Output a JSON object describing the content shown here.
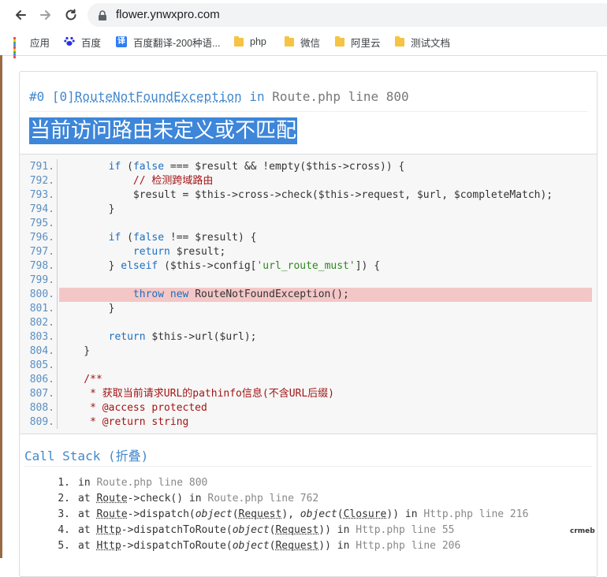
{
  "browser": {
    "url": "flower.ynwxpro.com",
    "bookmarks": [
      "应用",
      "百度",
      "百度翻译-200种语...",
      "php",
      "微信",
      "阿里云",
      "测试文档"
    ]
  },
  "exception": {
    "header_prefix": "#0 [0]",
    "header_class": "RouteNotFoundException",
    "header_in": "in",
    "header_location": "Route.php line 800",
    "message": "当前访问路由未定义或不匹配"
  },
  "source": {
    "highlight_line": "800.",
    "lines": [
      {
        "no": "791.",
        "code": "        if (false === $result && !empty($this->cross)) {"
      },
      {
        "no": "792.",
        "code": "            // 检测跨域路由"
      },
      {
        "no": "793.",
        "code": "            $result = $this->cross->check($this->request, $url, $completeMatch);"
      },
      {
        "no": "794.",
        "code": "        }"
      },
      {
        "no": "795.",
        "code": ""
      },
      {
        "no": "796.",
        "code": "        if (false !== $result) {"
      },
      {
        "no": "797.",
        "code": "            return $result;"
      },
      {
        "no": "798.",
        "code": "        } elseif ($this->config['url_route_must']) {"
      },
      {
        "no": "799.",
        "code": ""
      },
      {
        "no": "800.",
        "code": "            throw new RouteNotFoundException();"
      },
      {
        "no": "801.",
        "code": "        }"
      },
      {
        "no": "802.",
        "code": ""
      },
      {
        "no": "803.",
        "code": "        return $this->url($url);"
      },
      {
        "no": "804.",
        "code": "    }"
      },
      {
        "no": "805.",
        "code": ""
      },
      {
        "no": "806.",
        "code": "    /**"
      },
      {
        "no": "807.",
        "code": "     * 获取当前请求URL的pathinfo信息(不含URL后缀)"
      },
      {
        "no": "808.",
        "code": "     * @access protected"
      },
      {
        "no": "809.",
        "code": "     * @return string"
      }
    ]
  },
  "callstack": {
    "title": "Call Stack (折叠)",
    "items": [
      {
        "num": "1.",
        "parts": [
          {
            "t": "in ",
            "c": ""
          },
          {
            "t": "Route.php line 800",
            "c": "file"
          }
        ]
      },
      {
        "num": "2.",
        "parts": [
          {
            "t": "at ",
            "c": ""
          },
          {
            "t": "Route",
            "c": "cls"
          },
          {
            "t": "->check() in ",
            "c": ""
          },
          {
            "t": "Route.php line 762",
            "c": "file"
          }
        ]
      },
      {
        "num": "3.",
        "parts": [
          {
            "t": "at ",
            "c": ""
          },
          {
            "t": "Route",
            "c": "cls"
          },
          {
            "t": "->dispatch(",
            "c": ""
          },
          {
            "t": "object",
            "c": "it"
          },
          {
            "t": "(",
            "c": ""
          },
          {
            "t": "Request",
            "c": "cls"
          },
          {
            "t": "), ",
            "c": ""
          },
          {
            "t": "object",
            "c": "it"
          },
          {
            "t": "(",
            "c": ""
          },
          {
            "t": "Closure",
            "c": "cls"
          },
          {
            "t": ")) in ",
            "c": ""
          },
          {
            "t": "Http.php line 216",
            "c": "file"
          }
        ]
      },
      {
        "num": "4.",
        "parts": [
          {
            "t": "at ",
            "c": ""
          },
          {
            "t": "Http",
            "c": "cls"
          },
          {
            "t": "->dispatchToRoute(",
            "c": ""
          },
          {
            "t": "object",
            "c": "it"
          },
          {
            "t": "(",
            "c": ""
          },
          {
            "t": "Request",
            "c": "cls"
          },
          {
            "t": ")) in ",
            "c": ""
          },
          {
            "t": "Http.php line 55",
            "c": "file"
          }
        ]
      },
      {
        "num": "5.",
        "parts": [
          {
            "t": "at ",
            "c": ""
          },
          {
            "t": "Http",
            "c": "cls"
          },
          {
            "t": "->dispatchToRoute(",
            "c": ""
          },
          {
            "t": "object",
            "c": "it"
          },
          {
            "t": "(",
            "c": ""
          },
          {
            "t": "Request",
            "c": "cls"
          },
          {
            "t": ")) in ",
            "c": ""
          },
          {
            "t": "Http.php line 206",
            "c": "file"
          }
        ]
      }
    ]
  },
  "watermark": "crmeb"
}
